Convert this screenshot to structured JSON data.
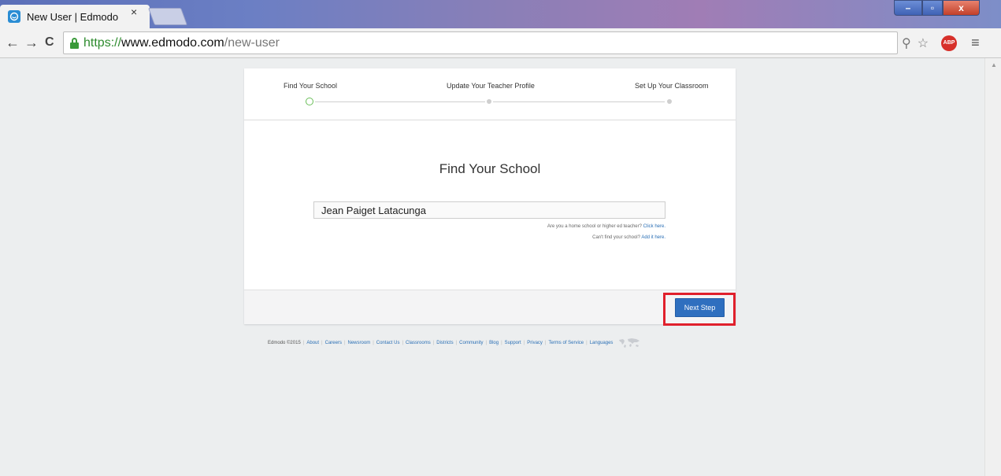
{
  "browser": {
    "tab_title": "New User | Edmodo",
    "tab_close": "×",
    "url_scheme": "https://",
    "url_host": "www.edmodo.com",
    "url_path": "/new-user",
    "back": "←",
    "forward": "→",
    "reload": "C",
    "zoom_icon": "⚲",
    "star_icon": "☆",
    "adblock_label": "ABP",
    "menu_icon": "≡"
  },
  "window_controls": {
    "minimize": "–",
    "maximize": "▫",
    "close": "x"
  },
  "progress": {
    "steps": [
      {
        "label": "Find Your School",
        "state": "current"
      },
      {
        "label": "Update Your Teacher Profile",
        "state": "pending"
      },
      {
        "label": "Set Up Your Classroom",
        "state": "pending"
      }
    ]
  },
  "form": {
    "title": "Find Your School",
    "school_value": "Jean Paiget Latacunga",
    "home_school_text": "Are you a home school or higher ed teacher?",
    "home_school_link": "Click here.",
    "not_found_text": "Can't find your school?",
    "not_found_link": "Add it here.",
    "next_label": "Next Step"
  },
  "footer": {
    "copyright": "Edmodo ©2015",
    "links": [
      "About",
      "Careers",
      "Newsroom",
      "Contact Us",
      "Classrooms",
      "Districts",
      "Community",
      "Blog",
      "Support",
      "Privacy",
      "Terms of Service",
      "Languages"
    ]
  },
  "colors": {
    "brand_blue": "#2f6fbf",
    "active_step": "#6bbf5a",
    "highlight": "#e0202c"
  }
}
